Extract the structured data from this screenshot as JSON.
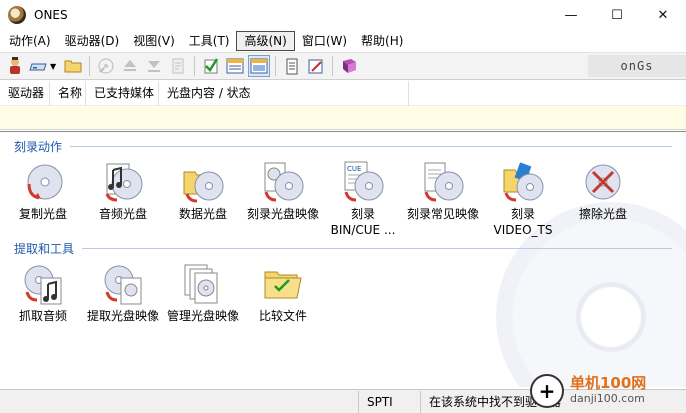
{
  "window": {
    "title": "ONES",
    "controls": {
      "minimize": "—",
      "maximize": "☐",
      "close": "✕"
    }
  },
  "menu": [
    {
      "label": "动作(A)"
    },
    {
      "label": "驱动器(D)"
    },
    {
      "label": "视图(V)"
    },
    {
      "label": "工具(T)"
    },
    {
      "label": "高级(N)",
      "active": true
    },
    {
      "label": "窗口(W)"
    },
    {
      "label": "帮助(H)"
    }
  ],
  "toolbar": {
    "brand": "onGs"
  },
  "columns": [
    {
      "label": "驱动器"
    },
    {
      "label": "名称"
    },
    {
      "label": "已支持媒体"
    },
    {
      "label": "光盘内容 / 状态"
    }
  ],
  "sections": {
    "burn": {
      "title": "刻录动作",
      "items": [
        {
          "label": "复制光盘",
          "icon": "copy-disc-icon"
        },
        {
          "label": "音频光盘",
          "icon": "audio-disc-icon"
        },
        {
          "label": "数据光盘",
          "icon": "data-disc-icon"
        },
        {
          "label": "刻录光盘映像",
          "icon": "burn-image-icon"
        },
        {
          "label": "刻录",
          "label2": "BIN/CUE ...",
          "icon": "burn-bincue-icon"
        },
        {
          "label": "刻录常见映像",
          "icon": "burn-common-image-icon"
        },
        {
          "label": "刻录",
          "label2": "VIDEO_TS",
          "icon": "burn-video-ts-icon"
        },
        {
          "label": "擦除光盘",
          "icon": "erase-disc-icon"
        }
      ]
    },
    "extract": {
      "title": "提取和工具",
      "items": [
        {
          "label": "抓取音频",
          "icon": "rip-audio-icon"
        },
        {
          "label": "提取光盘映像",
          "icon": "extract-image-icon"
        },
        {
          "label": "管理光盘映像",
          "icon": "manage-images-icon"
        },
        {
          "label": "比较文件",
          "icon": "compare-files-icon"
        }
      ]
    }
  },
  "status": {
    "interface": "SPTI",
    "message": "在该系统中找不到驱动器"
  },
  "watermark": {
    "site_cn": "单机100网",
    "site_url": "danji100.com"
  }
}
